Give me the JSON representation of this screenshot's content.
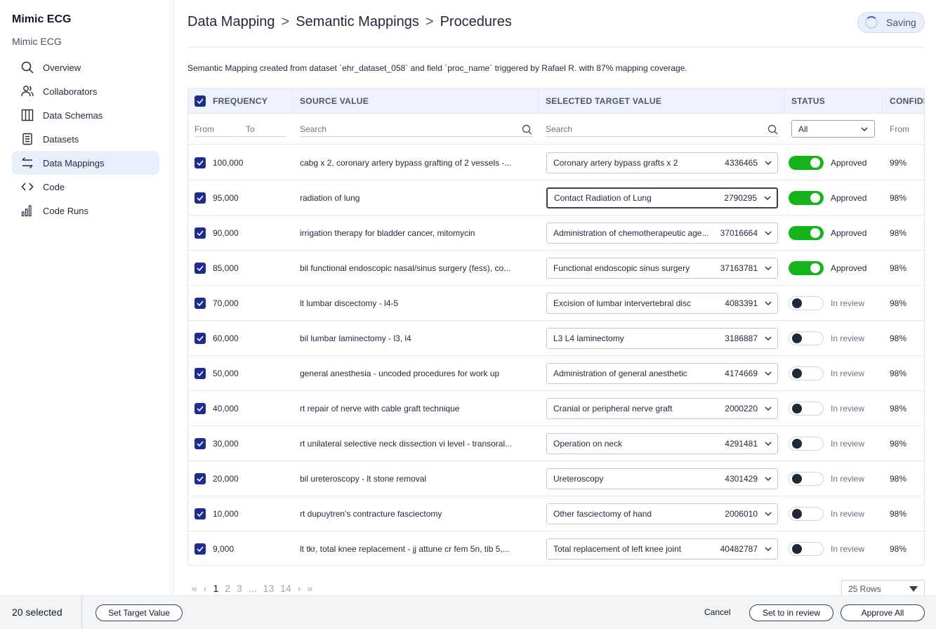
{
  "sidebar": {
    "org_name": "Mimic ECG",
    "org_sub": "Mimic ECG",
    "items": [
      {
        "label": "Overview",
        "icon": "search-icon"
      },
      {
        "label": "Collaborators",
        "icon": "users-icon"
      },
      {
        "label": "Data Schemas",
        "icon": "columns-icon"
      },
      {
        "label": "Datasets",
        "icon": "database-icon"
      },
      {
        "label": "Data Mappings",
        "icon": "arrows-exchange-icon",
        "active": true
      },
      {
        "label": "Code",
        "icon": "code-icon"
      },
      {
        "label": "Code Runs",
        "icon": "bar-chart-icon"
      }
    ]
  },
  "header": {
    "crumb1": "Data Mapping",
    "crumb2": "Semantic Mappings",
    "crumb3": "Procedures",
    "separator": ">",
    "saving_label": "Saving",
    "description": "Semantic Mapping created from dataset `ehr_dataset_058` and field `proc_name` triggered by Rafael R. with 87% mapping coverage."
  },
  "table": {
    "columns": {
      "frequency": "FREQUENCY",
      "source": "SOURCE VALUE",
      "target": "SELECTED TARGET VALUE",
      "status": "STATUS",
      "confidence": "CONFIDE"
    },
    "filters": {
      "from": "From",
      "to": "To",
      "source_search": "Search",
      "target_search": "Search",
      "status_value": "All",
      "conf_from": "From"
    },
    "rows": [
      {
        "frequency": "100,000",
        "source": "cabg x 2, coronary artery bypass grafting of 2 vessels -...",
        "target": "Coronary artery bypass grafts x 2",
        "code": "4336465",
        "approved": true,
        "status": "Approved",
        "confidence": "99%"
      },
      {
        "frequency": "95,000",
        "source": "radiation of lung",
        "target": "Contact Radiation of Lung",
        "code": "2790295",
        "approved": true,
        "status": "Approved",
        "confidence": "98%",
        "focused": true
      },
      {
        "frequency": "90,000",
        "source": "irrigation therapy for bladder cancer, mitomycin",
        "target": "Administration of chemotherapeutic age...",
        "code": "37016664",
        "approved": true,
        "status": "Approved",
        "confidence": "98%"
      },
      {
        "frequency": "85,000",
        "source": "bil functional endoscopic nasal/sinus surgery (fess), co...",
        "target": "Functional endoscopic sinus surgery",
        "code": "37163781",
        "approved": true,
        "status": "Approved",
        "confidence": "98%"
      },
      {
        "frequency": "70,000",
        "source": "lt lumbar discectomy   - l4-5",
        "target": "Excision of lumbar intervertebral disc",
        "code": "4083391",
        "approved": false,
        "status": "In review",
        "confidence": "98%"
      },
      {
        "frequency": "60,000",
        "source": "bil lumbar laminectomy   - l3, l4",
        "target": "L3 L4 laminectomy",
        "code": "3186887",
        "approved": false,
        "status": "In review",
        "confidence": "98%"
      },
      {
        "frequency": "50,000",
        "source": "general anesthesia - uncoded procedures for work up",
        "target": "Administration of general anesthetic",
        "code": "4174669",
        "approved": false,
        "status": "In review",
        "confidence": "98%"
      },
      {
        "frequency": "40,000",
        "source": "rt repair of nerve with cable graft technique",
        "target": "Cranial or peripheral nerve graft",
        "code": "2000220",
        "approved": false,
        "status": "In review",
        "confidence": "98%"
      },
      {
        "frequency": "30,000",
        "source": "rt unilateral selective neck dissection vi level   - transoral...",
        "target": "Operation on neck",
        "code": "4291481",
        "approved": false,
        "status": "In review",
        "confidence": "98%"
      },
      {
        "frequency": "20,000",
        "source": "bil ureteroscopy   - lt stone removal",
        "target": "Ureteroscopy",
        "code": "4301429",
        "approved": false,
        "status": "In review",
        "confidence": "98%"
      },
      {
        "frequency": "10,000",
        "source": "rt dupuytren's contracture fasciectomy",
        "target": "Other fasciectomy of hand",
        "code": "2006010",
        "approved": false,
        "status": "In review",
        "confidence": "98%"
      },
      {
        "frequency": "9,000",
        "source": "lt tkr, total knee replacement   - jj attune cr fem 5n, tib 5,...",
        "target": "Total replacement of left knee joint",
        "code": "40482787",
        "approved": false,
        "status": "In review",
        "confidence": "98%"
      }
    ]
  },
  "pagination": {
    "first": "«",
    "prev": "‹",
    "pages": [
      "1",
      "2",
      "3",
      "...",
      "13",
      "14"
    ],
    "current": "1",
    "next": "›",
    "last": "»",
    "rows_label": "25 Rows"
  },
  "bottombar": {
    "selected": "20 selected",
    "set_target": "Set Target Value",
    "cancel": "Cancel",
    "set_review": "Set to in review",
    "approve_all": "Approve All"
  },
  "colors": {
    "accent": "#1e2b8f",
    "toggle_on": "#16b31b",
    "active_nav": "#e8eefc"
  }
}
